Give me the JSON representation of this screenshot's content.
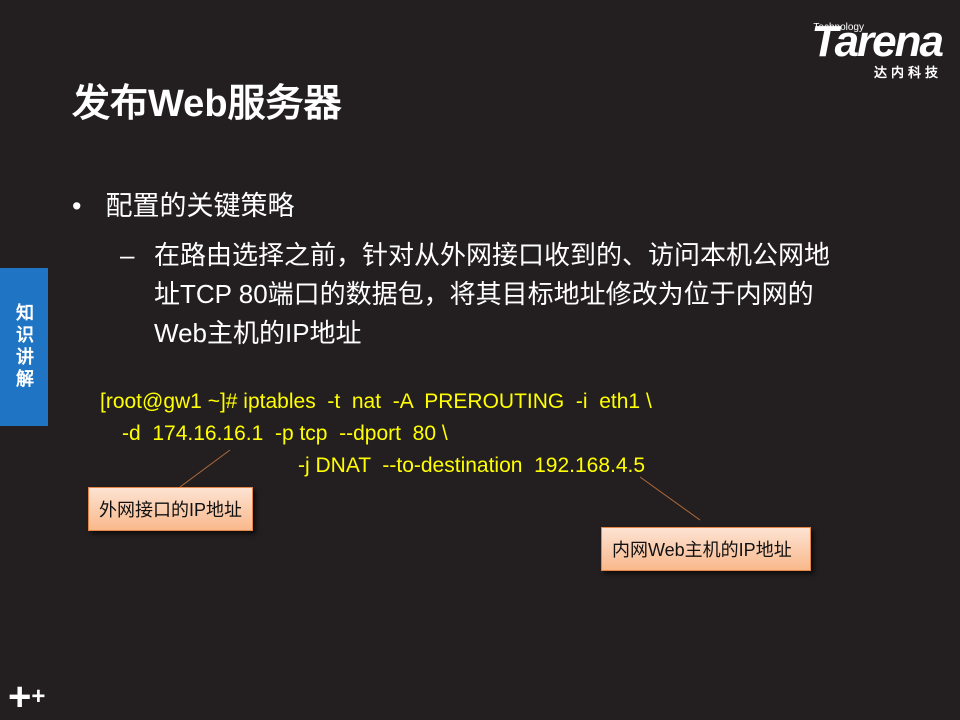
{
  "title": "发布Web服务器",
  "logo": {
    "brand": "Tarena",
    "tagline": "Technology",
    "cn": "达内科技"
  },
  "side_tab": "知识讲解",
  "bullet": {
    "marker": "•",
    "text": "配置的关键策略"
  },
  "sub_bullet": {
    "marker": "–",
    "text": "在路由选择之前，针对从外网接口收到的、访问本机公网地址TCP 80端口的数据包，将其目标地址修改为位于内网的Web主机的IP地址"
  },
  "code": [
    "[root@gw1 ~]# iptables  -t  nat  -A  PREROUTING  -i  eth1 \\",
    "-d  174.16.16.1  -p tcp  --dport  80 \\",
    "-j DNAT  --to-destination  192.168.4.5"
  ],
  "callouts": [
    "外网接口的IP地址",
    "内网Web主机的IP地址"
  ],
  "colors": {
    "background": "#231f20",
    "code": "#ffff00",
    "side_tab": "#1f74c4"
  }
}
